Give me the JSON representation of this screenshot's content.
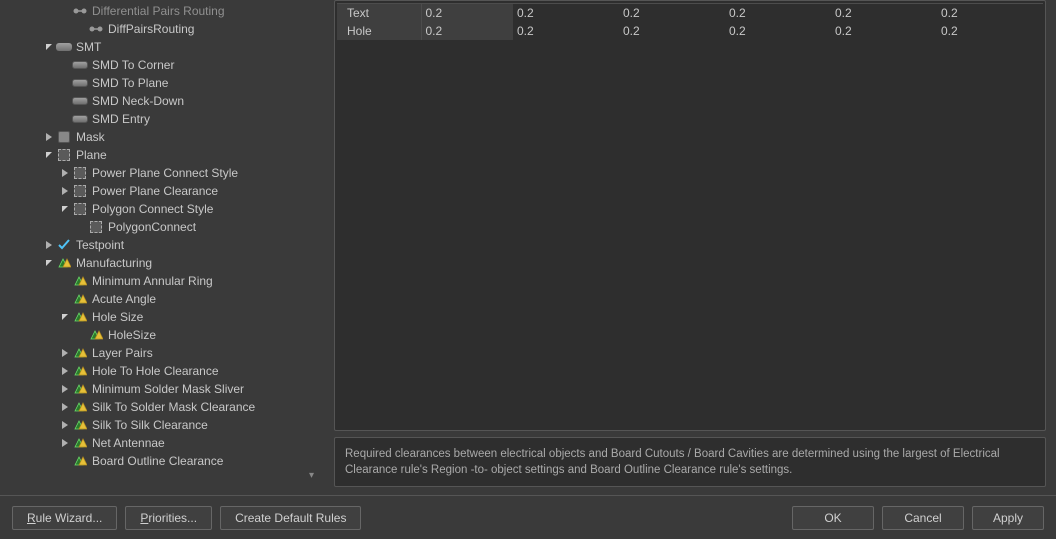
{
  "tree": [
    {
      "indent": 2,
      "expand": "none",
      "icon": "diff",
      "label": "Differential Pairs Routing",
      "cut": true
    },
    {
      "indent": 3,
      "expand": "none",
      "icon": "diff",
      "label": "DiffPairsRouting"
    },
    {
      "indent": 1,
      "expand": "open",
      "icon": "smt",
      "label": "SMT"
    },
    {
      "indent": 2,
      "expand": "none",
      "icon": "smd",
      "label": "SMD To Corner"
    },
    {
      "indent": 2,
      "expand": "none",
      "icon": "smd",
      "label": "SMD To Plane"
    },
    {
      "indent": 2,
      "expand": "none",
      "icon": "smd",
      "label": "SMD Neck-Down"
    },
    {
      "indent": 2,
      "expand": "none",
      "icon": "smd",
      "label": "SMD Entry"
    },
    {
      "indent": 1,
      "expand": "closed",
      "icon": "mask",
      "label": "Mask"
    },
    {
      "indent": 1,
      "expand": "open",
      "icon": "plane",
      "label": "Plane"
    },
    {
      "indent": 2,
      "expand": "closed",
      "icon": "plane",
      "label": "Power Plane Connect Style"
    },
    {
      "indent": 2,
      "expand": "closed",
      "icon": "plane",
      "label": "Power Plane Clearance"
    },
    {
      "indent": 2,
      "expand": "open",
      "icon": "plane",
      "label": "Polygon Connect Style"
    },
    {
      "indent": 3,
      "expand": "none",
      "icon": "plane",
      "label": "PolygonConnect"
    },
    {
      "indent": 1,
      "expand": "closed",
      "icon": "check",
      "label": "Testpoint"
    },
    {
      "indent": 1,
      "expand": "open",
      "icon": "mfg",
      "label": "Manufacturing"
    },
    {
      "indent": 2,
      "expand": "none",
      "icon": "mfg",
      "label": "Minimum Annular Ring"
    },
    {
      "indent": 2,
      "expand": "none",
      "icon": "mfg",
      "label": "Acute Angle"
    },
    {
      "indent": 2,
      "expand": "open",
      "icon": "mfg",
      "label": "Hole Size"
    },
    {
      "indent": 3,
      "expand": "none",
      "icon": "mfg",
      "label": "HoleSize"
    },
    {
      "indent": 2,
      "expand": "closed",
      "icon": "mfg",
      "label": "Layer Pairs"
    },
    {
      "indent": 2,
      "expand": "closed",
      "icon": "mfg",
      "label": "Hole To Hole Clearance"
    },
    {
      "indent": 2,
      "expand": "closed",
      "icon": "mfg",
      "label": "Minimum Solder Mask Sliver"
    },
    {
      "indent": 2,
      "expand": "closed",
      "icon": "mfg",
      "label": "Silk To Solder Mask Clearance"
    },
    {
      "indent": 2,
      "expand": "closed",
      "icon": "mfg",
      "label": "Silk To Silk Clearance"
    },
    {
      "indent": 2,
      "expand": "closed",
      "icon": "mfg",
      "label": "Net Antennae"
    },
    {
      "indent": 2,
      "expand": "none",
      "icon": "mfg",
      "label": "Board Outline Clearance"
    }
  ],
  "grid": {
    "rows": [
      {
        "name": "Text",
        "v": [
          "0.2",
          "0.2",
          "0.2",
          "0.2",
          "0.2",
          "0.2"
        ]
      },
      {
        "name": "Hole",
        "v": [
          "0.2",
          "0.2",
          "0.2",
          "0.2",
          "0.2",
          "0.2"
        ]
      }
    ]
  },
  "note": "Required clearances between electrical objects and Board Cutouts / Board Cavities are determined using the largest of Electrical Clearance rule's Region -to- object settings and Board Outline Clearance rule's settings.",
  "buttons": {
    "wizard_pre": "R",
    "wizard": "ule Wizard...",
    "prio_pre": "P",
    "prio": "riorities...",
    "defaults": "Create Default Rules",
    "ok": "OK",
    "cancel": "Cancel",
    "apply": "Apply"
  }
}
